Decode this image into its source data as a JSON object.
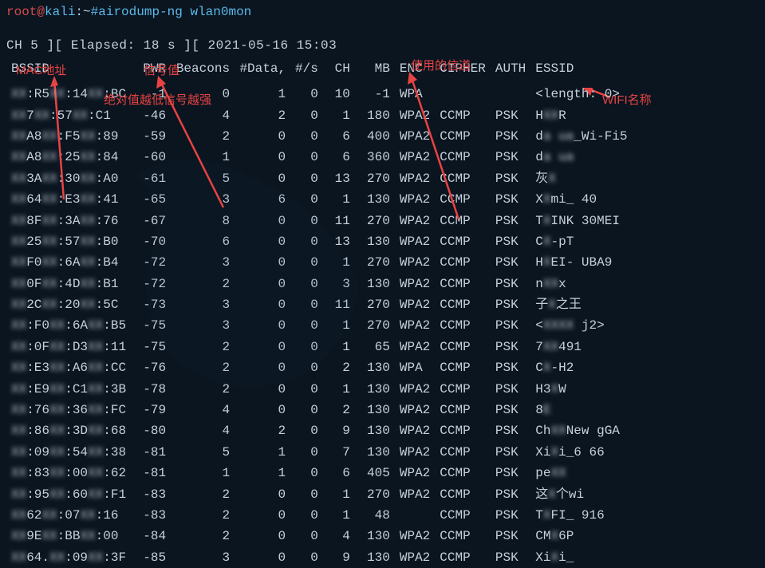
{
  "prompt": {
    "user": "root",
    "at": "@",
    "host": "kali",
    "colon": ":",
    "path": "~",
    "hash": "#",
    "command": "airodump-ng wlan0mon"
  },
  "status_line": " CH  5 ][ Elapsed: 18 s ][ 2021-05-16 15:03",
  "annotations": {
    "mac": "MAC地址",
    "signal": "信号值",
    "signal_note": "绝对值越低信号越强",
    "channel": "使用的信道",
    "wifi_name": "WIFI名称"
  },
  "headers": {
    "bssid": "BSSID",
    "pwr": "PWR",
    "beacons": "Beacons",
    "data": "#Data,",
    "ps": "#/s",
    "ch": "CH",
    "mb": "MB",
    "enc": "ENC",
    "cipher": "CIPHER",
    "auth": "AUTH",
    "essid": "ESSID"
  },
  "rows": [
    {
      "bssid_vis1": "",
      "bssid_mask1": "XX",
      "bssid_vis2": ":R5",
      "bssid_mask2": "XX",
      "bssid_vis3": ":14",
      "bssid_mask3": "XX",
      "bssid_vis4": ":BC",
      "pwr": "-1",
      "beacons": "0",
      "data": "1",
      "ps": "0",
      "ch": "10",
      "mb": "-1",
      "enc": "WPA",
      "cipher": "",
      "auth": "",
      "essid_pre": "<length:",
      "essid_blur": "",
      "essid_aft": "  0>"
    },
    {
      "bssid_vis1": "",
      "bssid_mask1": "XX",
      "bssid_vis2": "7",
      "bssid_mask2": "XX",
      "bssid_vis3": ":57",
      "bssid_mask3": "XX",
      "bssid_vis4": ":C1",
      "pwr": "-46",
      "beacons": "4",
      "data": "2",
      "ps": "0",
      "ch": "1",
      "mb": "180",
      "enc": "WPA2",
      "cipher": "CCMP",
      "auth": "PSK",
      "essid_pre": "H",
      "essid_blur": "XX",
      "essid_aft": "R"
    },
    {
      "bssid_vis1": "",
      "bssid_mask1": "XX",
      "bssid_vis2": "A8",
      "bssid_mask2": "XX",
      "bssid_vis3": ":F5",
      "bssid_mask3": "XX",
      "bssid_vis4": ":89",
      "pwr": "-59",
      "beacons": "2",
      "data": "0",
      "ps": "0",
      "ch": "6",
      "mb": "400",
      "enc": "WPA2",
      "cipher": "CCMP",
      "auth": "PSK",
      "essid_pre": "d",
      "essid_blur": "a  ua",
      "essid_aft": "_Wi-Fi5"
    },
    {
      "bssid_vis1": "",
      "bssid_mask1": "XX",
      "bssid_vis2": "A8",
      "bssid_mask2": "XX",
      "bssid_vis3": ":25",
      "bssid_mask3": "XX",
      "bssid_vis4": ":84",
      "pwr": "-60",
      "beacons": "1",
      "data": "0",
      "ps": "0",
      "ch": "6",
      "mb": "360",
      "enc": "WPA2",
      "cipher": "CCMP",
      "auth": "PSK",
      "essid_pre": "d",
      "essid_blur": "a  ua",
      "essid_aft": ""
    },
    {
      "bssid_vis1": "",
      "bssid_mask1": "XX",
      "bssid_vis2": "3A",
      "bssid_mask2": "XX",
      "bssid_vis3": ":30",
      "bssid_mask3": "XX",
      "bssid_vis4": ":A0",
      "pwr": "-61",
      "beacons": "5",
      "data": "0",
      "ps": "0",
      "ch": "13",
      "mb": "270",
      "enc": "WPA2",
      "cipher": "CCMP",
      "auth": "PSK",
      "essid_pre": "灰",
      "essid_blur": "X",
      "essid_aft": ""
    },
    {
      "bssid_vis1": "",
      "bssid_mask1": "XX",
      "bssid_vis2": "64",
      "bssid_mask2": "XX",
      "bssid_vis3": ":E3",
      "bssid_mask3": "XX",
      "bssid_vis4": ":41",
      "pwr": "-65",
      "beacons": "3",
      "data": "6",
      "ps": "0",
      "ch": "1",
      "mb": "130",
      "enc": "WPA2",
      "cipher": "CCMP",
      "auth": "PSK",
      "essid_pre": "X",
      "essid_blur": "X",
      "essid_aft": "mi_  40"
    },
    {
      "bssid_vis1": "",
      "bssid_mask1": "XX",
      "bssid_vis2": "8F",
      "bssid_mask2": "XX",
      "bssid_vis3": ":3A",
      "bssid_mask3": "XX",
      "bssid_vis4": ":76",
      "pwr": "-67",
      "beacons": "8",
      "data": "0",
      "ps": "0",
      "ch": "11",
      "mb": "270",
      "enc": "WPA2",
      "cipher": "CCMP",
      "auth": "PSK",
      "essid_pre": "T",
      "essid_blur": "X",
      "essid_aft": "INK  30MEI"
    },
    {
      "bssid_vis1": "",
      "bssid_mask1": "XX",
      "bssid_vis2": "25",
      "bssid_mask2": "XX",
      "bssid_vis3": ":57",
      "bssid_mask3": "XX",
      "bssid_vis4": ":B0",
      "pwr": "-70",
      "beacons": "6",
      "data": "0",
      "ps": "0",
      "ch": "13",
      "mb": "130",
      "enc": "WPA2",
      "cipher": "CCMP",
      "auth": "PSK",
      "essid_pre": "C",
      "essid_blur": "X",
      "essid_aft": "-pT"
    },
    {
      "bssid_vis1": "",
      "bssid_mask1": "XX",
      "bssid_vis2": "F0",
      "bssid_mask2": "XX",
      "bssid_vis3": ":6A",
      "bssid_mask3": "XX",
      "bssid_vis4": ":B4",
      "pwr": "-72",
      "beacons": "3",
      "data": "0",
      "ps": "0",
      "ch": "1",
      "mb": "270",
      "enc": "WPA2",
      "cipher": "CCMP",
      "auth": "PSK",
      "essid_pre": "H",
      "essid_blur": "X",
      "essid_aft": "EI-  UBA9"
    },
    {
      "bssid_vis1": "",
      "bssid_mask1": "XX",
      "bssid_vis2": "0F",
      "bssid_mask2": "XX",
      "bssid_vis3": ":4D",
      "bssid_mask3": "XX",
      "bssid_vis4": ":B1",
      "pwr": "-72",
      "beacons": "2",
      "data": "0",
      "ps": "0",
      "ch": "3",
      "mb": "130",
      "enc": "WPA2",
      "cipher": "CCMP",
      "auth": "PSK",
      "essid_pre": "n",
      "essid_blur": "XX",
      "essid_aft": "x"
    },
    {
      "bssid_vis1": "",
      "bssid_mask1": "XX",
      "bssid_vis2": "2C",
      "bssid_mask2": "XX",
      "bssid_vis3": ":20",
      "bssid_mask3": "XX",
      "bssid_vis4": ":5C",
      "pwr": "-73",
      "beacons": "3",
      "data": "0",
      "ps": "0",
      "ch": "11",
      "mb": "270",
      "enc": "WPA2",
      "cipher": "CCMP",
      "auth": "PSK",
      "essid_pre": "子",
      "essid_blur": "X",
      "essid_aft": "之王"
    },
    {
      "bssid_vis1": "",
      "bssid_mask1": "XX",
      "bssid_vis2": ":F0",
      "bssid_mask2": "XX",
      "bssid_vis3": ":6A",
      "bssid_mask3": "XX",
      "bssid_vis4": ":B5",
      "pwr": "-75",
      "beacons": "3",
      "data": "0",
      "ps": "0",
      "ch": "1",
      "mb": "270",
      "enc": "WPA2",
      "cipher": "CCMP",
      "auth": "PSK",
      "essid_pre": "<",
      "essid_blur": "XXXX",
      "essid_aft": "  j2>"
    },
    {
      "bssid_vis1": "",
      "bssid_mask1": "XX",
      "bssid_vis2": ":0F",
      "bssid_mask2": "XX",
      "bssid_vis3": ":D3",
      "bssid_mask3": "XX",
      "bssid_vis4": ":11",
      "pwr": "-75",
      "beacons": "2",
      "data": "0",
      "ps": "0",
      "ch": "1",
      "mb": "65",
      "enc": "WPA2",
      "cipher": "CCMP",
      "auth": "PSK",
      "essid_pre": "7",
      "essid_blur": "XX",
      "essid_aft": "491"
    },
    {
      "bssid_vis1": "",
      "bssid_mask1": "XX",
      "bssid_vis2": ":E3",
      "bssid_mask2": "XX",
      "bssid_vis3": ":A6",
      "bssid_mask3": "XX",
      "bssid_vis4": ":CC",
      "pwr": "-76",
      "beacons": "2",
      "data": "0",
      "ps": "0",
      "ch": "2",
      "mb": "130",
      "enc": "WPA",
      "cipher": "CCMP",
      "auth": "PSK",
      "essid_pre": "C",
      "essid_blur": "X",
      "essid_aft": "-H2"
    },
    {
      "bssid_vis1": "",
      "bssid_mask1": "XX",
      "bssid_vis2": ":E9",
      "bssid_mask2": "XX",
      "bssid_vis3": ":C1",
      "bssid_mask3": "XX",
      "bssid_vis4": ":3B",
      "pwr": "-78",
      "beacons": "2",
      "data": "0",
      "ps": "0",
      "ch": "1",
      "mb": "130",
      "enc": "WPA2",
      "cipher": "CCMP",
      "auth": "PSK",
      "essid_pre": "H3",
      "essid_blur": "X",
      "essid_aft": "W"
    },
    {
      "bssid_vis1": "",
      "bssid_mask1": "XX",
      "bssid_vis2": ":76",
      "bssid_mask2": "XX",
      "bssid_vis3": ":36",
      "bssid_mask3": "XX",
      "bssid_vis4": ":FC",
      "pwr": "-79",
      "beacons": "4",
      "data": "0",
      "ps": "0",
      "ch": "2",
      "mb": "130",
      "enc": "WPA2",
      "cipher": "CCMP",
      "auth": "PSK",
      "essid_pre": "8",
      "essid_blur": "E",
      "essid_aft": ""
    },
    {
      "bssid_vis1": "",
      "bssid_mask1": "XX",
      "bssid_vis2": ":86",
      "bssid_mask2": "XX",
      "bssid_vis3": ":3D",
      "bssid_mask3": "XX",
      "bssid_vis4": ":68",
      "pwr": "-80",
      "beacons": "4",
      "data": "2",
      "ps": "0",
      "ch": "9",
      "mb": "130",
      "enc": "WPA2",
      "cipher": "CCMP",
      "auth": "PSK",
      "essid_pre": "Ch",
      "essid_blur": "XX",
      "essid_aft": "New  gGA"
    },
    {
      "bssid_vis1": "",
      "bssid_mask1": "XX",
      "bssid_vis2": ":09",
      "bssid_mask2": "XX",
      "bssid_vis3": ":54",
      "bssid_mask3": "XX",
      "bssid_vis4": ":38",
      "pwr": "-81",
      "beacons": "5",
      "data": "1",
      "ps": "0",
      "ch": "7",
      "mb": "130",
      "enc": "WPA2",
      "cipher": "CCMP",
      "auth": "PSK",
      "essid_pre": "Xi",
      "essid_blur": "X",
      "essid_aft": "i_6  66"
    },
    {
      "bssid_vis1": "",
      "bssid_mask1": "XX",
      "bssid_vis2": ":83",
      "bssid_mask2": "XX",
      "bssid_vis3": ":00",
      "bssid_mask3": "XX",
      "bssid_vis4": ":62",
      "pwr": "-81",
      "beacons": "1",
      "data": "1",
      "ps": "0",
      "ch": "6",
      "mb": "405",
      "enc": "WPA2",
      "cipher": "CCMP",
      "auth": "PSK",
      "essid_pre": "pe",
      "essid_blur": "XX",
      "essid_aft": ""
    },
    {
      "bssid_vis1": "",
      "bssid_mask1": "XX",
      "bssid_vis2": ":95",
      "bssid_mask2": "XX",
      "bssid_vis3": ":60",
      "bssid_mask3": "XX",
      "bssid_vis4": ":F1",
      "pwr": "-83",
      "beacons": "2",
      "data": "0",
      "ps": "0",
      "ch": "1",
      "mb": "270",
      "enc": "WPA2",
      "cipher": "CCMP",
      "auth": "PSK",
      "essid_pre": "这",
      "essid_blur": "X",
      "essid_aft": "个wi"
    },
    {
      "bssid_vis1": "",
      "bssid_mask1": "XX",
      "bssid_vis2": "62",
      "bssid_mask2": "XX",
      "bssid_vis3": ":07",
      "bssid_mask3": "XX",
      "bssid_vis4": ":16",
      "pwr": "-83",
      "beacons": "2",
      "data": "0",
      "ps": "0",
      "ch": "1",
      "mb": "48",
      "enc": "",
      "cipher": "CCMP",
      "auth": "PSK",
      "essid_pre": "T",
      "essid_blur": "X",
      "essid_aft": "FI_  916"
    },
    {
      "bssid_vis1": "",
      "bssid_mask1": "XX",
      "bssid_vis2": "9E",
      "bssid_mask2": "XX",
      "bssid_vis3": ":BB",
      "bssid_mask3": "XX",
      "bssid_vis4": ":00",
      "pwr": "-84",
      "beacons": "2",
      "data": "0",
      "ps": "0",
      "ch": "4",
      "mb": "130",
      "enc": "WPA2",
      "cipher": "CCMP",
      "auth": "PSK",
      "essid_pre": "CM",
      "essid_blur": "X",
      "essid_aft": "6P"
    },
    {
      "bssid_vis1": "",
      "bssid_mask1": "XX",
      "bssid_vis2": "64.",
      "bssid_mask2": "XX",
      "bssid_vis3": ":09",
      "bssid_mask3": "XX",
      "bssid_vis4": ":3F",
      "pwr": "-85",
      "beacons": "3",
      "data": "0",
      "ps": "0",
      "ch": "9",
      "mb": "130",
      "enc": "WPA2",
      "cipher": "CCMP",
      "auth": "PSK",
      "essid_pre": "Xi",
      "essid_blur": "X",
      "essid_aft": "i_"
    }
  ]
}
